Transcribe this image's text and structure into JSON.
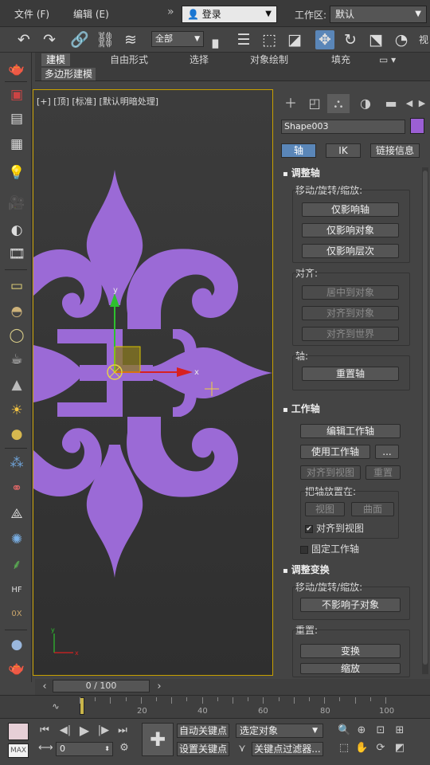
{
  "menubar": {
    "items": [
      "文件 (F)",
      "编辑 (E)"
    ],
    "more": "»",
    "login": "登录",
    "workspace_label": "工作区:",
    "workspace_value": "默认"
  },
  "toolbar": {
    "selection_filter": "全部"
  },
  "ribbon": {
    "tabs": [
      "建模",
      "自由形式",
      "选择",
      "对象绘制",
      "填充"
    ],
    "active_tab": "建模",
    "sub_tab": "多边形建模"
  },
  "viewport": {
    "label": "[+] [顶] [标准] [默认明暗处理]",
    "gizmo": {
      "y_label": "y",
      "x_label": "x"
    },
    "axis_tripod": {
      "y_label": "y",
      "x_label": "x"
    },
    "shape_color": "#9b6ad6"
  },
  "command_panel": {
    "object_name": "Shape003",
    "object_color": "#9b5fd4",
    "subtabs": [
      "轴",
      "IK",
      "链接信息"
    ],
    "active_subtab": "轴",
    "adjust_pivot": {
      "title": "调整轴",
      "move_label": "移动/旋转/缩放:",
      "buttons": [
        "仅影响轴",
        "仅影响对象",
        "仅影响层次"
      ],
      "align_label": "对齐:",
      "align_buttons": [
        "居中到对象",
        "对齐到对象",
        "对齐到世界"
      ],
      "pivot_label": "轴:",
      "reset_pivot": "重置轴"
    },
    "working_pivot": {
      "title": "工作轴",
      "edit": "编辑工作轴",
      "use": "使用工作轴",
      "ellipsis": "...",
      "align_view": "对齐到视图",
      "reset": "重置",
      "place_label": "把轴放置在:",
      "view": "视图",
      "surface": "曲面",
      "align_to_view_check": "对齐到视图",
      "lock_working_pivot": "固定工作轴"
    },
    "adjust_transform": {
      "title": "调整变换",
      "move_label": "移动/旋转/缩放:",
      "dont_affect_children": "不影响子对象",
      "reset_label": "重置:",
      "transform": "变换",
      "scale": "缩放"
    }
  },
  "timeline": {
    "frame_display": "0 / 100",
    "ticks": [
      "20",
      "40",
      "60",
      "80",
      "100"
    ]
  },
  "bottom": {
    "max_label": "MAX",
    "frame_value": "0",
    "auto_key": "自动关键点",
    "set_key": "设置关键点",
    "selected_object": "选定对象",
    "key_filter": "关键点过滤器..."
  }
}
